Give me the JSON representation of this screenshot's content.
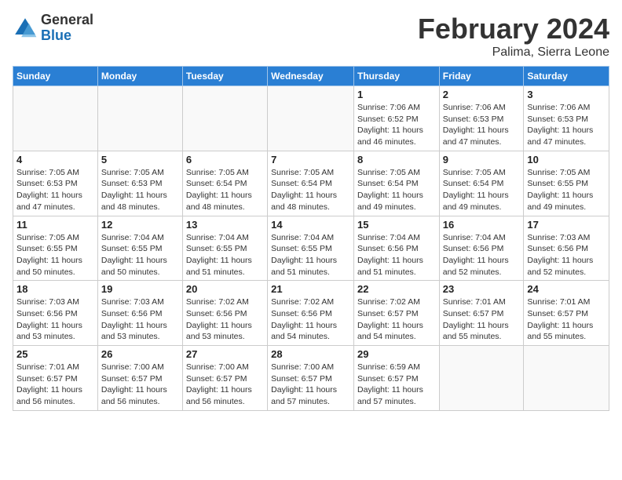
{
  "header": {
    "logo_general": "General",
    "logo_blue": "Blue",
    "main_title": "February 2024",
    "subtitle": "Palima, Sierra Leone"
  },
  "weekdays": [
    "Sunday",
    "Monday",
    "Tuesday",
    "Wednesday",
    "Thursday",
    "Friday",
    "Saturday"
  ],
  "weeks": [
    [
      {
        "day": "",
        "info": ""
      },
      {
        "day": "",
        "info": ""
      },
      {
        "day": "",
        "info": ""
      },
      {
        "day": "",
        "info": ""
      },
      {
        "day": "1",
        "info": "Sunrise: 7:06 AM\nSunset: 6:52 PM\nDaylight: 11 hours and 46 minutes."
      },
      {
        "day": "2",
        "info": "Sunrise: 7:06 AM\nSunset: 6:53 PM\nDaylight: 11 hours and 47 minutes."
      },
      {
        "day": "3",
        "info": "Sunrise: 7:06 AM\nSunset: 6:53 PM\nDaylight: 11 hours and 47 minutes."
      }
    ],
    [
      {
        "day": "4",
        "info": "Sunrise: 7:05 AM\nSunset: 6:53 PM\nDaylight: 11 hours and 47 minutes."
      },
      {
        "day": "5",
        "info": "Sunrise: 7:05 AM\nSunset: 6:53 PM\nDaylight: 11 hours and 48 minutes."
      },
      {
        "day": "6",
        "info": "Sunrise: 7:05 AM\nSunset: 6:54 PM\nDaylight: 11 hours and 48 minutes."
      },
      {
        "day": "7",
        "info": "Sunrise: 7:05 AM\nSunset: 6:54 PM\nDaylight: 11 hours and 48 minutes."
      },
      {
        "day": "8",
        "info": "Sunrise: 7:05 AM\nSunset: 6:54 PM\nDaylight: 11 hours and 49 minutes."
      },
      {
        "day": "9",
        "info": "Sunrise: 7:05 AM\nSunset: 6:54 PM\nDaylight: 11 hours and 49 minutes."
      },
      {
        "day": "10",
        "info": "Sunrise: 7:05 AM\nSunset: 6:55 PM\nDaylight: 11 hours and 49 minutes."
      }
    ],
    [
      {
        "day": "11",
        "info": "Sunrise: 7:05 AM\nSunset: 6:55 PM\nDaylight: 11 hours and 50 minutes."
      },
      {
        "day": "12",
        "info": "Sunrise: 7:04 AM\nSunset: 6:55 PM\nDaylight: 11 hours and 50 minutes."
      },
      {
        "day": "13",
        "info": "Sunrise: 7:04 AM\nSunset: 6:55 PM\nDaylight: 11 hours and 51 minutes."
      },
      {
        "day": "14",
        "info": "Sunrise: 7:04 AM\nSunset: 6:55 PM\nDaylight: 11 hours and 51 minutes."
      },
      {
        "day": "15",
        "info": "Sunrise: 7:04 AM\nSunset: 6:56 PM\nDaylight: 11 hours and 51 minutes."
      },
      {
        "day": "16",
        "info": "Sunrise: 7:04 AM\nSunset: 6:56 PM\nDaylight: 11 hours and 52 minutes."
      },
      {
        "day": "17",
        "info": "Sunrise: 7:03 AM\nSunset: 6:56 PM\nDaylight: 11 hours and 52 minutes."
      }
    ],
    [
      {
        "day": "18",
        "info": "Sunrise: 7:03 AM\nSunset: 6:56 PM\nDaylight: 11 hours and 53 minutes."
      },
      {
        "day": "19",
        "info": "Sunrise: 7:03 AM\nSunset: 6:56 PM\nDaylight: 11 hours and 53 minutes."
      },
      {
        "day": "20",
        "info": "Sunrise: 7:02 AM\nSunset: 6:56 PM\nDaylight: 11 hours and 53 minutes."
      },
      {
        "day": "21",
        "info": "Sunrise: 7:02 AM\nSunset: 6:56 PM\nDaylight: 11 hours and 54 minutes."
      },
      {
        "day": "22",
        "info": "Sunrise: 7:02 AM\nSunset: 6:57 PM\nDaylight: 11 hours and 54 minutes."
      },
      {
        "day": "23",
        "info": "Sunrise: 7:01 AM\nSunset: 6:57 PM\nDaylight: 11 hours and 55 minutes."
      },
      {
        "day": "24",
        "info": "Sunrise: 7:01 AM\nSunset: 6:57 PM\nDaylight: 11 hours and 55 minutes."
      }
    ],
    [
      {
        "day": "25",
        "info": "Sunrise: 7:01 AM\nSunset: 6:57 PM\nDaylight: 11 hours and 56 minutes."
      },
      {
        "day": "26",
        "info": "Sunrise: 7:00 AM\nSunset: 6:57 PM\nDaylight: 11 hours and 56 minutes."
      },
      {
        "day": "27",
        "info": "Sunrise: 7:00 AM\nSunset: 6:57 PM\nDaylight: 11 hours and 56 minutes."
      },
      {
        "day": "28",
        "info": "Sunrise: 7:00 AM\nSunset: 6:57 PM\nDaylight: 11 hours and 57 minutes."
      },
      {
        "day": "29",
        "info": "Sunrise: 6:59 AM\nSunset: 6:57 PM\nDaylight: 11 hours and 57 minutes."
      },
      {
        "day": "",
        "info": ""
      },
      {
        "day": "",
        "info": ""
      }
    ]
  ]
}
